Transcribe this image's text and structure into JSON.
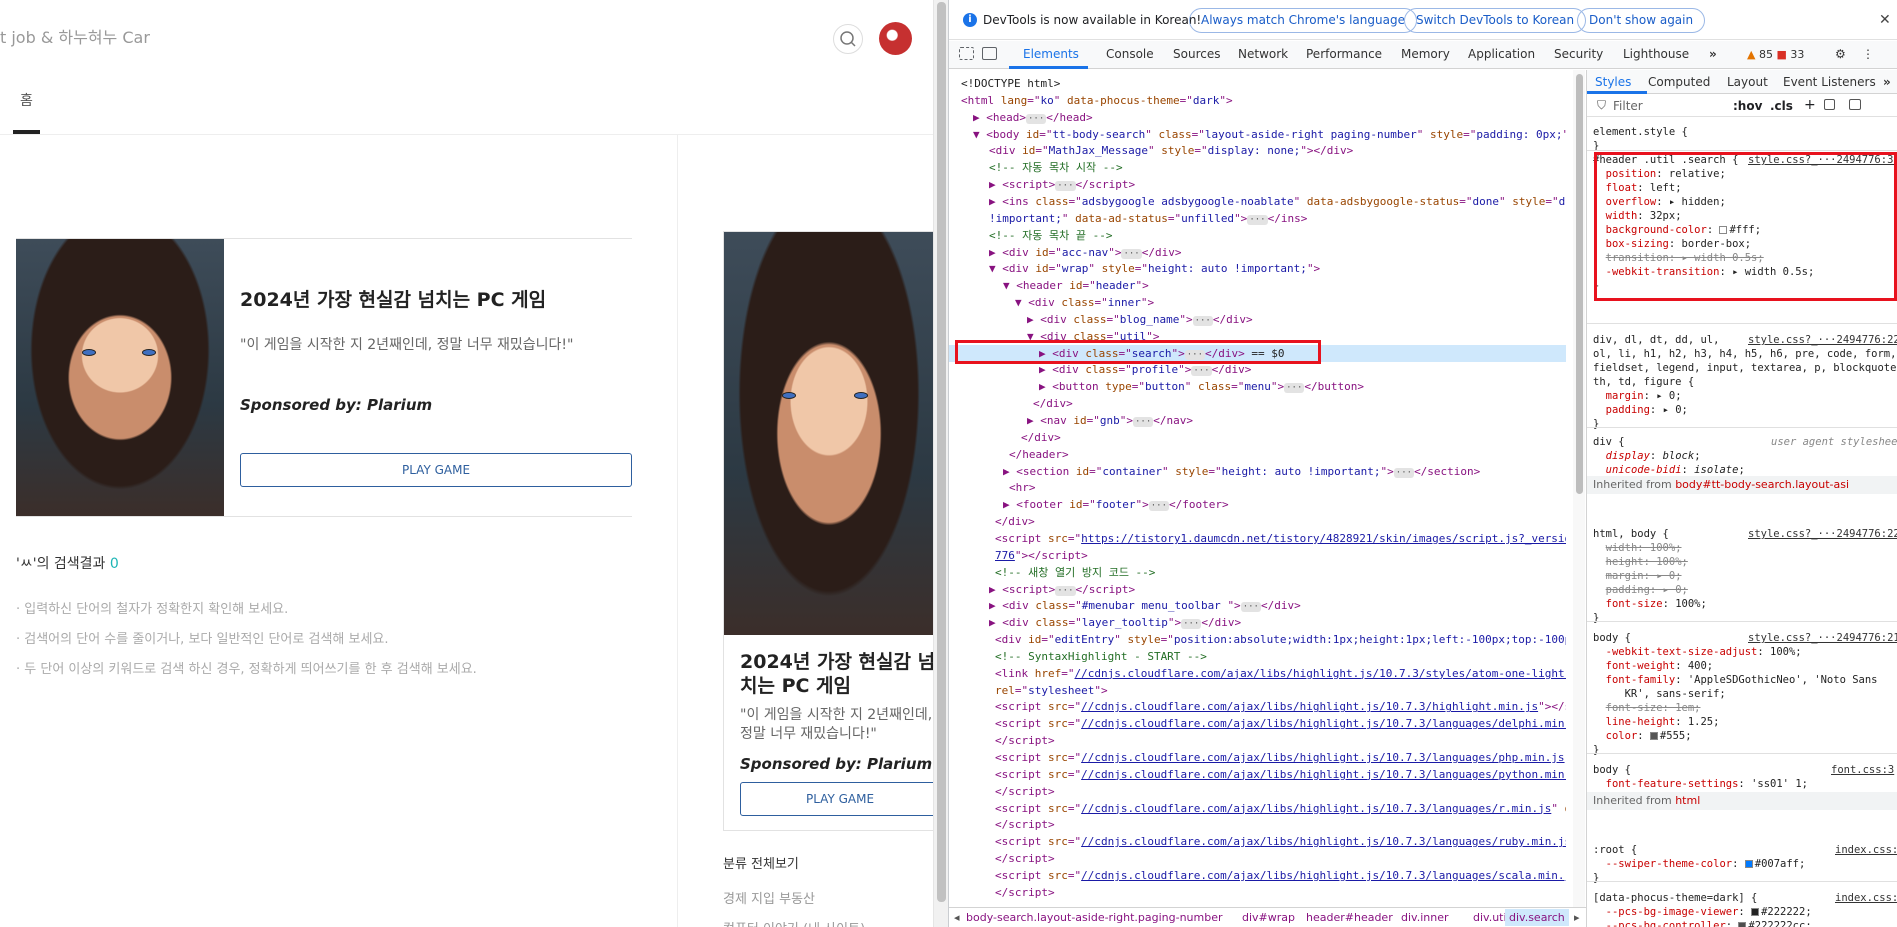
{
  "blog": {
    "name": "t job & 하누혀누 Car",
    "tab_home": "홈",
    "ad_main": {
      "title": "2024년 가장 현실감 넘치는 PC 게임",
      "quote": "\"이 게임을 시작한 지 2년째인데, 정말 너무 재밌습니다!\"",
      "sponsor": "Sponsored by: Plarium",
      "button": "PLAY GAME"
    },
    "ad_side": {
      "title": "2024년 가장 현실감 넘치는 PC 게임",
      "quote": "\"이 게임을 시작한 지 2년째인데, 정말 너무 재밌습니다!\"",
      "sponsor": "Sponsored by: Plarium",
      "button": "PLAY GAME"
    },
    "search_result": {
      "prefix": "'ㅆ'의 검색결과",
      "count": "0",
      "hints": [
        "· 입력하신 단어의 철자가 정확한지 확인해 보세요.",
        "· 검색어의 단어 수를 줄이거나, 보다 일반적인 단어로 검색해 보세요.",
        "· 두 단어 이상의 키워드로 검색 하신 경우, 정확하게 띄어쓰기를 한 후 검색해 보세요."
      ]
    },
    "category": {
      "all": "분류 전체보기",
      "items": [
        "경제 지입 부동산",
        "컴퓨터 이야기 (내 사이트)"
      ]
    }
  },
  "devtools": {
    "infobar": {
      "message": "DevTools is now available in Korean!",
      "buttons": [
        "Always match Chrome's language",
        "Switch DevTools to Korean",
        "Don't show again"
      ],
      "close": "✕"
    },
    "tabs": [
      "Elements",
      "Console",
      "Sources",
      "Network",
      "Performance",
      "Memory",
      "Application",
      "Security",
      "Lighthouse"
    ],
    "more_tabs": "»",
    "warnings": "85",
    "errors": "33",
    "styles_tabs": [
      "Styles",
      "Computed",
      "Layout",
      "Event Listeners"
    ],
    "styles_more": "»",
    "filter_placeholder": "Filter",
    "filter_buttons": [
      ":hov",
      ".cls",
      "+"
    ],
    "breadcrumbs": [
      "body-search.layout-aside-right.paging-number",
      "div#wrap",
      "header#header",
      "div.inner",
      "div.util",
      "div.search"
    ],
    "colors": {
      "accent": "#1a73e8",
      "highlight_box": "#e8121e",
      "tag": "#881280",
      "attr_name": "#994500",
      "attr_value": "#1a1aa6",
      "comment": "#236e25"
    }
  }
}
